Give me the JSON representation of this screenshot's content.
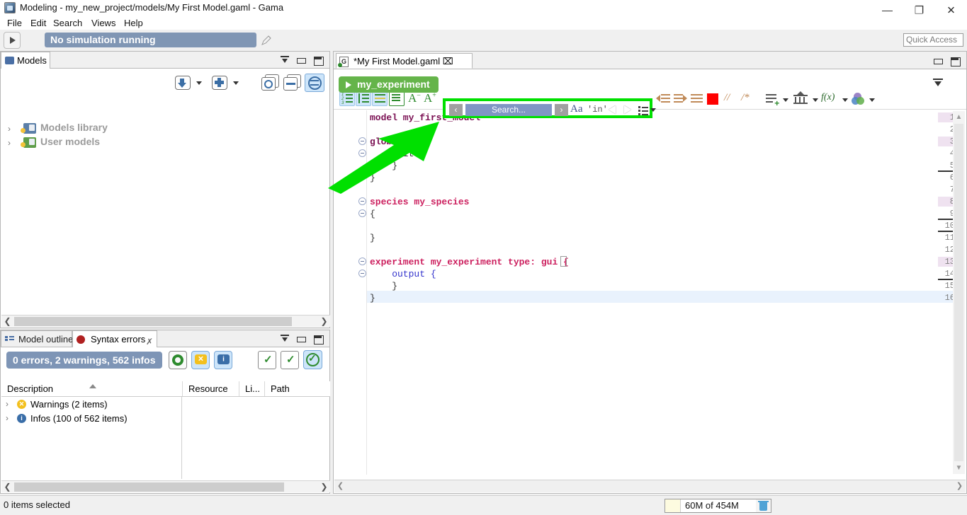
{
  "window": {
    "title": "Modeling - my_new_project/models/My First Model.gaml - Gama",
    "minimize": "—",
    "maximize": "❐",
    "close": "✕"
  },
  "menu": {
    "items": [
      "File",
      "Edit",
      "Search",
      "Views",
      "Help"
    ]
  },
  "toolbar": {
    "simulation_status": "No simulation running",
    "quick_access_placeholder": "Quick Access"
  },
  "models_panel": {
    "tab_label": "Models",
    "tree": [
      {
        "twisty": "›",
        "label": "Models library",
        "icon": "folder-lock-icon"
      },
      {
        "twisty": "›",
        "label": "User models",
        "icon": "folder-user-icon"
      }
    ],
    "toolbar_icons": [
      "import-models-icon",
      "new-model-icon",
      "history-icon",
      "collapse-all-icon",
      "link-editor-icon"
    ]
  },
  "errors_panel": {
    "tabs": [
      {
        "label": "Model outline",
        "active": false
      },
      {
        "label": "Syntax errors",
        "active": true
      }
    ],
    "badge": "0 errors, 2 warnings, 562 infos",
    "columns": [
      "Description",
      "Resource",
      "Li...",
      "Path"
    ],
    "rows": [
      {
        "twisty": "›",
        "kind": "warning",
        "glyph": "✕",
        "label": "Warnings (2 items)"
      },
      {
        "twisty": "›",
        "kind": "info",
        "glyph": "i",
        "label": "Infos (100 of 562 items)"
      }
    ]
  },
  "editor": {
    "tab_label": "*My First Model.gaml",
    "tab_close": "⌧",
    "experiment_button": "my_experiment",
    "search": {
      "prev_label": "‹",
      "next_label": "›",
      "placeholder": "Search...",
      "case_label": "Aa",
      "word_label": "'in'",
      "highlight_color": "#00e000"
    },
    "font_smaller": "A",
    "font_larger": "A",
    "font_smaller_sup": "−",
    "font_larger_sup": "+",
    "comment_line": "//",
    "comment_block": "/*",
    "fx_label": "f(x)",
    "lines": [
      {
        "n": "1",
        "folded": false,
        "hl": true,
        "text": "model my_first_model"
      },
      {
        "n": "2",
        "folded": false,
        "hl": false,
        "text": ""
      },
      {
        "n": "3",
        "folded": true,
        "hl": false,
        "text": "global {"
      },
      {
        "n": "4",
        "folded": true,
        "hl": false,
        "text": "    init {"
      },
      {
        "n": "5",
        "folded": false,
        "hl": false,
        "text": "    }"
      },
      {
        "n": "6",
        "folded": false,
        "hl": false,
        "text": "}"
      },
      {
        "n": "7",
        "folded": false,
        "hl": false,
        "text": ""
      },
      {
        "n": "8",
        "folded": true,
        "hl": true,
        "text": "species my_species"
      },
      {
        "n": "9",
        "folded": true,
        "hl": false,
        "text": "{"
      },
      {
        "n": "10",
        "folded": false,
        "hl": false,
        "text": ""
      },
      {
        "n": "11",
        "folded": false,
        "hl": false,
        "text": "}"
      },
      {
        "n": "12",
        "folded": false,
        "hl": false,
        "text": ""
      },
      {
        "n": "13",
        "folded": true,
        "hl": true,
        "text": "experiment my_experiment type: gui {"
      },
      {
        "n": "14",
        "folded": true,
        "hl": false,
        "text": "    output {"
      },
      {
        "n": "15",
        "folded": false,
        "hl": false,
        "text": "    }"
      },
      {
        "n": "16",
        "folded": false,
        "hl": false,
        "text": "}"
      }
    ]
  },
  "statusbar": {
    "selection": "0 items selected",
    "memory": "60M of 454M"
  }
}
